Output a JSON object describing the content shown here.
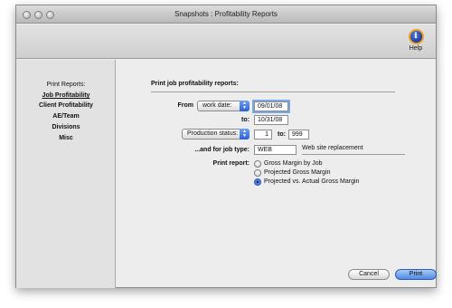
{
  "window": {
    "title": "Snapshots : Profitability Reports"
  },
  "toolbar": {
    "help_label": "Help",
    "help_glyph": "i"
  },
  "sidebar": {
    "heading": "Print Reports:",
    "items": [
      {
        "label": "Job Profitability",
        "active": true
      },
      {
        "label": "Client Profitability",
        "active": false
      },
      {
        "label": "AE/Team",
        "active": false
      },
      {
        "label": "Divisions",
        "active": false
      },
      {
        "label": "Misc",
        "active": false
      }
    ]
  },
  "main": {
    "heading": "Print job profitability reports:",
    "from_label": "From",
    "date_popup": "work date:",
    "date_from": "09/01/08",
    "to_label": "to:",
    "date_to": "10/31/08",
    "status_popup": "Production status:",
    "status_from": "1",
    "status_to_label": "to:",
    "status_to": "999",
    "job_type_label": "...and for job type:",
    "job_type_code": "WEB",
    "job_type_desc": "Web site replacement",
    "print_report_label": "Print report:",
    "report_options": [
      {
        "label": "Gross Margin by Job",
        "checked": false
      },
      {
        "label": "Projected Gross Margin",
        "checked": false
      },
      {
        "label": "Projected vs. Actual Gross Margin",
        "checked": true
      }
    ]
  },
  "buttons": {
    "cancel": "Cancel",
    "print": "Print"
  }
}
